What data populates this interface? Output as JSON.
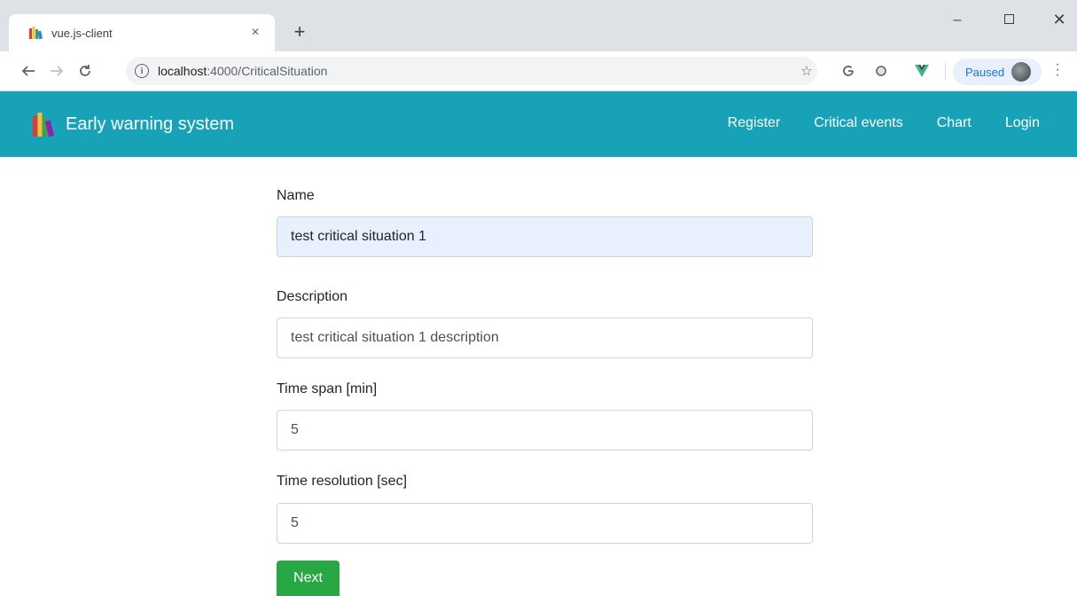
{
  "browser": {
    "tab_title": "vue.js-client",
    "tab_close_glyph": "×",
    "new_tab_glyph": "+",
    "url_host": "localhost",
    "url_path": ":4000/CriticalSituation",
    "paused_label": "Paused",
    "window_controls": {
      "minimize": "–",
      "close": "✕"
    }
  },
  "navbar": {
    "brand": "Early warning system",
    "color": "#17a2b8",
    "links": [
      "Register",
      "Critical events",
      "Chart",
      "Login"
    ]
  },
  "form": {
    "name": {
      "label": "Name",
      "value": "test critical situation 1"
    },
    "description": {
      "label": "Description",
      "value": "test critical situation 1 description"
    },
    "time_span": {
      "label": "Time span [min]",
      "value": "5"
    },
    "time_resolution": {
      "label": "Time resolution [sec]",
      "value": "5"
    },
    "next_button": "Next",
    "button_color": "#28a745"
  },
  "icons": [
    "books-logo-icon",
    "back-arrow-icon",
    "forward-arrow-icon",
    "reload-icon",
    "info-icon",
    "star-icon",
    "google-icon",
    "extension-icon",
    "vue-devtools-icon",
    "menu-kebab-icon"
  ]
}
